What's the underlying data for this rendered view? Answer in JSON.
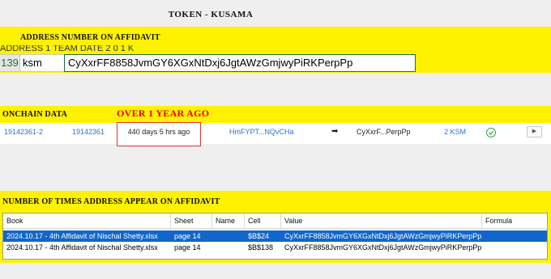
{
  "page_title": "TOKEN - KUSAMA",
  "section1": {
    "label": "ADDRESS NUMBER ON AFFIDAVIT",
    "cut_row_text": "ADDRESS 1 TEAM DATE 2 0 1 K",
    "row_number": "139",
    "symbol": "ksm",
    "address": "CyXxrFF8858JvmGY6XGxNtDxj6JgtAWzGmjwyPiRKPerpPp"
  },
  "section2": {
    "label": "ONCHAIN DATA",
    "annotation": "OVER 1 YEAR AGO",
    "tx": {
      "extrinsic": "19142361-2",
      "block": "19142361",
      "age": "440 days 5 hrs ago",
      "from": "HmFYPT...NQvCHa",
      "direction_icon": "arrow-right-icon",
      "to": "CyXxrF...PerpPp",
      "amount": "2 KSM",
      "status_icon": "success-check-icon",
      "expand_icon": "chevron-right-icon"
    }
  },
  "section3": {
    "label": "NUMBER OF TIMES ADDRESS APPEAR ON AFFIDAVIT",
    "columns": [
      "Book",
      "Sheet",
      "Name",
      "Cell",
      "Value",
      "Formula"
    ],
    "rows": [
      {
        "book": "2024.10.17 - 4th Affidavit of Nischal Shetty.xlsx",
        "sheet": "page 14",
        "name": "",
        "cell": "$B$24",
        "value": "CyXxrFF8858JvmGY6XGxNtDxj6JgtAWzGmjwyPiRKPerpPp",
        "formula": ""
      },
      {
        "book": "2024.10.17 - 4th Affidavit of Nischal Shetty.xlsx",
        "sheet": "page 14",
        "name": "",
        "cell": "$B$138",
        "value": "CyXxrFF8858JvmGY6XGxNtDxj6JgtAWzGmjwyPiRKPerpPp",
        "formula": ""
      }
    ]
  },
  "colors": {
    "highlight": "#fff200",
    "annotation": "#e8001c",
    "link": "#2a6fd6",
    "selected_row": "#1366c9"
  }
}
